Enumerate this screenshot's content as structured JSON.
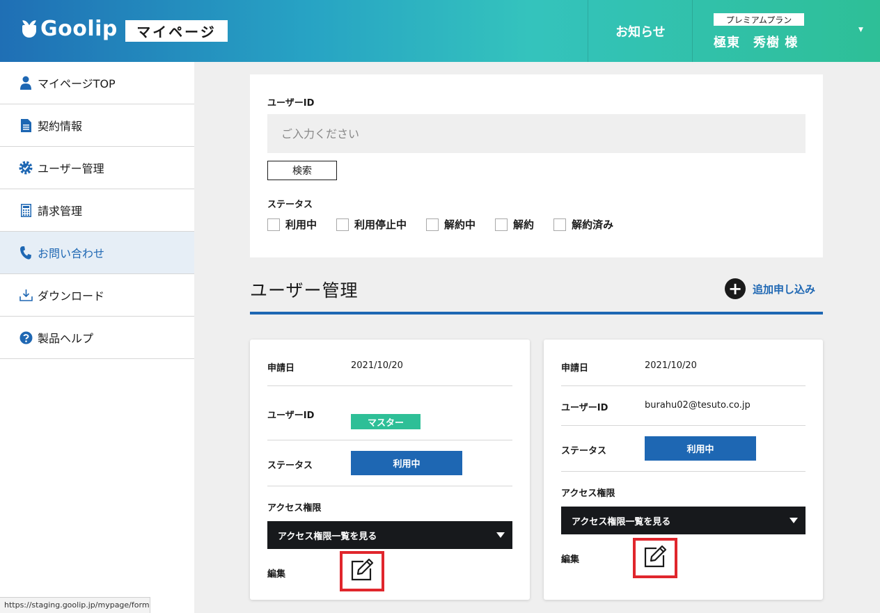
{
  "header": {
    "logo_text": "Goolip",
    "mypage_label": "マイページ",
    "notice_label": "お知らせ",
    "plan_label": "プレミアムプラン",
    "user_name": "極東　秀樹 様"
  },
  "sidebar": {
    "items": [
      {
        "label": "マイページTOP",
        "icon": "user-icon"
      },
      {
        "label": "契約情報",
        "icon": "document-icon"
      },
      {
        "label": "ユーザー管理",
        "icon": "user-gear-icon"
      },
      {
        "label": "請求管理",
        "icon": "calculator-icon"
      },
      {
        "label": "お問い合わせ",
        "icon": "phone-icon",
        "active": true
      },
      {
        "label": "ダウンロード",
        "icon": "download-icon"
      },
      {
        "label": "製品ヘルプ",
        "icon": "help-icon"
      }
    ]
  },
  "search": {
    "user_id_label": "ユーザーID",
    "placeholder": "ご入力ください",
    "search_button": "検索",
    "status_label": "ステータス",
    "status_options": [
      "利用中",
      "利用停止中",
      "解約中",
      "解約",
      "解約済み"
    ]
  },
  "section": {
    "title": "ユーザー管理",
    "add_label": "追加申し込み"
  },
  "cards": [
    {
      "date_label": "申請日",
      "date_value": "2021/10/20",
      "user_id_label": "ユーザーID",
      "user_id_value": "",
      "badge": "マスター",
      "status_label": "ステータス",
      "status_value": "利用中",
      "access_label": "アクセス権限",
      "access_dropdown": "アクセス権限一覧を見る",
      "edit_label": "編集"
    },
    {
      "date_label": "申請日",
      "date_value": "2021/10/20",
      "user_id_label": "ユーザーID",
      "user_id_value": "burahu02@tesuto.co.jp",
      "status_label": "ステータス",
      "status_value": "利用中",
      "access_label": "アクセス権限",
      "access_dropdown": "アクセス権限一覧を見る",
      "edit_label": "編集"
    }
  ],
  "statusbar": {
    "url": "https://staging.goolip.jp/mypage/form"
  },
  "colors": {
    "accent": "#1e67b3",
    "master": "#2ebf97",
    "highlight": "#e0262c"
  }
}
